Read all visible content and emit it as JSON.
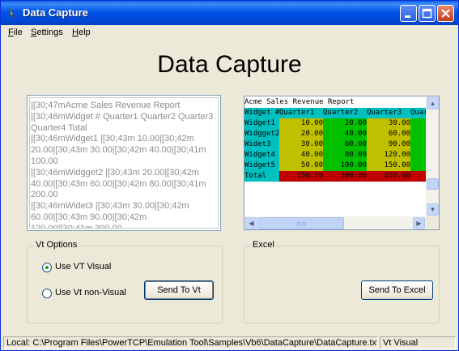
{
  "window": {
    "title": "Data Capture"
  },
  "menu": [
    {
      "label": "File",
      "key": "F"
    },
    {
      "label": "Settings",
      "key": "S"
    },
    {
      "label": "Help",
      "key": "H"
    }
  ],
  "heading": "Data Capture",
  "raw_lines": [
    "|[30;47mAcme Sales Revenue Report",
    "|[30;46mWidget #  Quarter1  Quarter2  Quarter3",
    "Quarter4     Total",
    "|[30;46mWidget1  |[30;43m    10.00|[30;42m",
    "20.00|[30;43m     30.00|[30;42m     40.00|[30;41m",
    "    100.00",
    "|[30;46mWidgget2  |[30;43m    20.00|[30;42m",
    "40.00|[30;43m     60.00|[30;42m     80.00|[30;41m",
    "    200.00",
    "|[30;46mWidet3  |[30;43m    30.00|[30;42m",
    "60.00|[30;43m     90.00|[30;42m",
    "120.00|[30;41m     300.00"
  ],
  "vt_report": {
    "title": "Acme Sales Revenue Report",
    "header": [
      "Widget #",
      "Quarter1",
      "Quarter2",
      "Quarter3",
      "Quart"
    ],
    "rows": [
      {
        "name": "Widget1",
        "q": [
          "10.00",
          "20.00",
          "30.00",
          "40"
        ]
      },
      {
        "name": "Widgget2",
        "q": [
          "20.00",
          "40.00",
          "60.00",
          "8"
        ]
      },
      {
        "name": "Widet3",
        "q": [
          "30.00",
          "60.00",
          "90.00",
          "120."
        ]
      },
      {
        "name": "Widget4",
        "q": [
          "40.00",
          "80.00",
          "120.00",
          "160"
        ]
      },
      {
        "name": "Widget5",
        "q": [
          "50.00",
          "100.00",
          "150.00",
          "200"
        ]
      }
    ],
    "total": {
      "name": "Total",
      "q": [
        "150.00",
        "300.00",
        "450.00",
        "600"
      ]
    },
    "colors": {
      "title_bg": "#ffffff",
      "header_bg": "#00c0c0",
      "name_bg": "#00c0c0",
      "odd_bg": "#c0c000",
      "even_bg": "#00c000",
      "total_bg": "#c00000",
      "total_name_bg": "#00c0c0"
    }
  },
  "vt_options": {
    "label": "Vt Options",
    "opt_visual": "Use VT Visual",
    "opt_nonvisual": "Use Vt non-Visual",
    "selected": "Use VT Visual",
    "send_button": "Send To Vt"
  },
  "excel": {
    "label": "Excel",
    "send_button": "Send To Excel"
  },
  "status": {
    "path": "Local: C:\\Program Files\\PowerTCP\\Emulation Tool\\Samples\\Vb6\\DataCapture\\DataCapture.txt",
    "mode": "Vt Visual"
  }
}
